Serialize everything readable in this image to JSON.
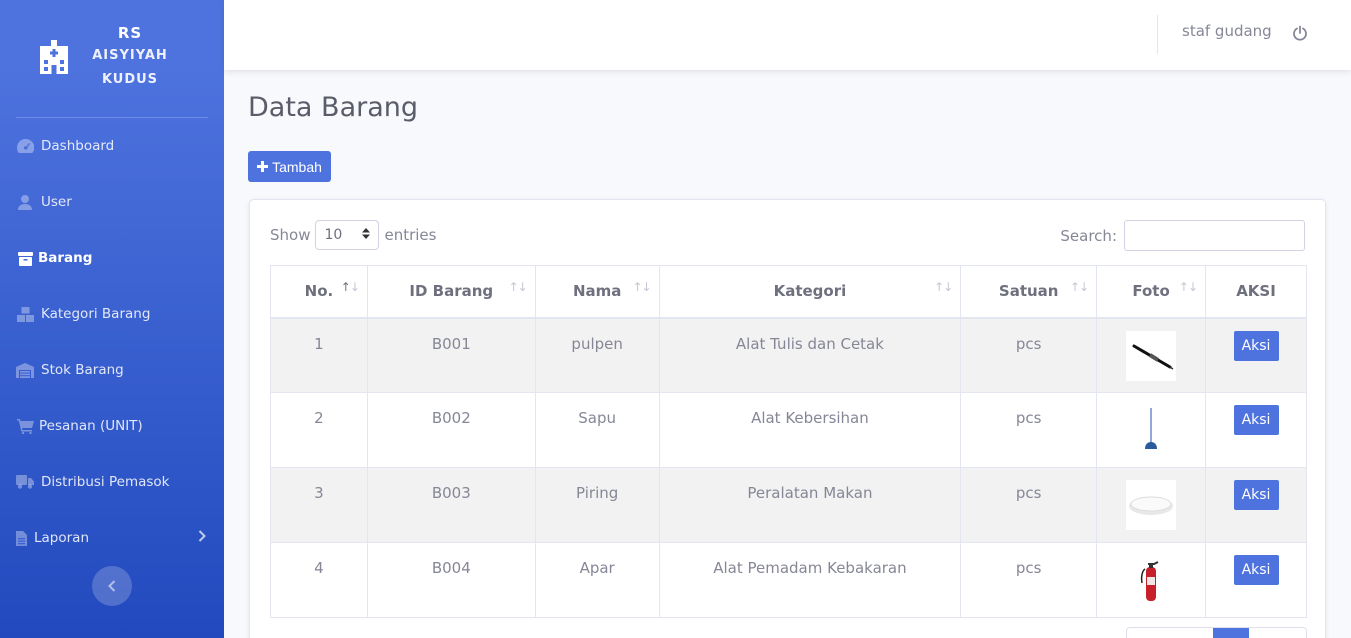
{
  "brand": {
    "line1": "RS",
    "line2": "AISYIYAH",
    "line3": "KUDUS"
  },
  "nav": {
    "items": [
      {
        "label": "Dashboard",
        "icon": "dashboard-icon"
      },
      {
        "label": "User",
        "icon": "user-icon"
      },
      {
        "label": "Barang",
        "icon": "box-icon",
        "active": true
      },
      {
        "label": "Kategori Barang",
        "icon": "boxes-icon"
      },
      {
        "label": "Stok Barang",
        "icon": "warehouse-icon"
      },
      {
        "label": "Pesanan (UNIT)",
        "icon": "cart-icon"
      },
      {
        "label": "Distribusi Pemasok",
        "icon": "truck-icon"
      },
      {
        "label": "Laporan",
        "icon": "file-icon"
      }
    ]
  },
  "topbar": {
    "user": "staf gudang"
  },
  "page": {
    "title": "Data Barang",
    "add_label": "Tambah"
  },
  "table": {
    "show_label": "Show",
    "entries_value": "10",
    "entries_label": "entries",
    "search_label": "Search:",
    "search_value": "",
    "columns": [
      "No.",
      "ID Barang",
      "Nama",
      "Kategori",
      "Satuan",
      "Foto",
      "AKSI"
    ],
    "rows": [
      {
        "no": "1",
        "id": "B001",
        "nama": "pulpen",
        "kategori": "Alat Tulis dan Cetak",
        "satuan": "pcs",
        "foto": "pen-photo",
        "aksi": "Aksi"
      },
      {
        "no": "2",
        "id": "B002",
        "nama": "Sapu",
        "kategori": "Alat Kebersihan",
        "satuan": "pcs",
        "foto": "broom-photo",
        "aksi": "Aksi"
      },
      {
        "no": "3",
        "id": "B003",
        "nama": "Piring",
        "kategori": "Peralatan Makan",
        "satuan": "pcs",
        "foto": "plate-photo",
        "aksi": "Aksi"
      },
      {
        "no": "4",
        "id": "B004",
        "nama": "Apar",
        "kategori": "Alat Pemadam Kebakaran",
        "satuan": "pcs",
        "foto": "extinguisher-photo",
        "aksi": "Aksi"
      }
    ]
  },
  "colors": {
    "primary": "#4e73df",
    "sidebar_dark": "#224abe"
  }
}
